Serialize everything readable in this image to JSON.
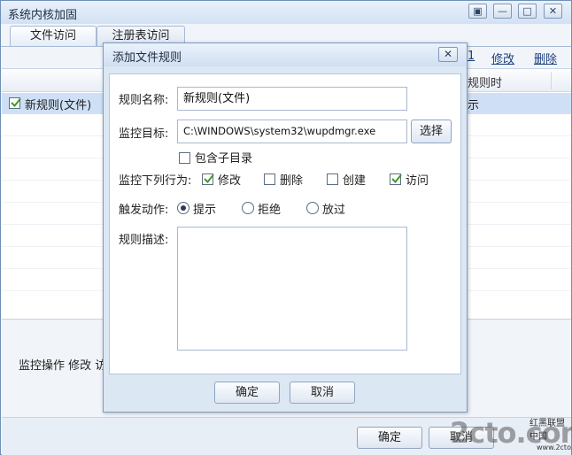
{
  "window": {
    "title": "系统内核加固",
    "controls": [
      "▣",
      "—",
      "□",
      "✕"
    ]
  },
  "tabs": [
    {
      "label": "文件访问",
      "active": true
    },
    {
      "label": "注册表访问",
      "active": false
    }
  ],
  "toolbar": {
    "partial_link": "1",
    "edit_label": "修改",
    "delete_label": "删除"
  },
  "list": {
    "header_partial": "规则时",
    "rows": [
      {
        "name": "新规则(文件)",
        "checked": true,
        "partial": "示"
      }
    ]
  },
  "status_text": "监控操作  修改  访",
  "bottom": {
    "ok_label": "确定",
    "cancel_partial": "取消"
  },
  "dialog": {
    "title": "添加文件规则",
    "close_glyph": "✕",
    "rule_name_label": "规则名称:",
    "rule_name_value": "新规则(文件)",
    "target_label": "监控目标:",
    "target_value": "C:\\WINDOWS\\system32\\wupdmgr.exe",
    "choose_label": "选择",
    "include_subdirs_label": "包含子目录",
    "include_subdirs_checked": false,
    "behaviors_label": "监控下列行为:",
    "behaviors": [
      {
        "label": "修改",
        "checked": true
      },
      {
        "label": "删除",
        "checked": false
      },
      {
        "label": "创建",
        "checked": false
      },
      {
        "label": "访问",
        "checked": true
      }
    ],
    "action_label": "触发动作:",
    "actions": [
      {
        "label": "提示",
        "selected": true
      },
      {
        "label": "拒绝",
        "selected": false
      },
      {
        "label": "放过",
        "selected": false
      }
    ],
    "description_label": "规则描述:",
    "description_value": "",
    "ok_label": "确定",
    "cancel_label": "取消"
  },
  "watermark": {
    "logo": "2cto.com",
    "side_top": "红黑联盟",
    "side_bottom": "中国",
    "side_url": "www.2cto.com"
  },
  "colors": {
    "check_green": "#3d9a2c",
    "selection_row": "#cfe0f6",
    "title_bar": "#d2e1f3"
  }
}
